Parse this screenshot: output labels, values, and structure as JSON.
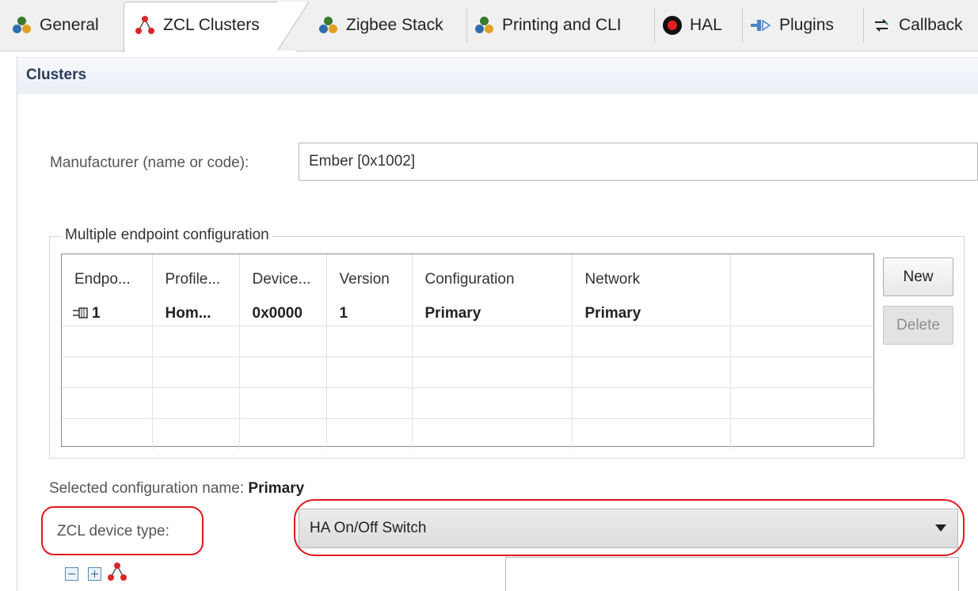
{
  "tabs": [
    {
      "label": "General",
      "icon": "cluster-icon"
    },
    {
      "label": "ZCL Clusters",
      "icon": "zcl-icon",
      "active": true
    },
    {
      "label": "Zigbee Stack",
      "icon": "cluster-icon"
    },
    {
      "label": "Printing and CLI",
      "icon": "cluster-icon"
    },
    {
      "label": "HAL",
      "icon": "hal-icon"
    },
    {
      "label": "Plugins",
      "icon": "plugin-icon"
    },
    {
      "label": "Callback",
      "icon": "callback-icon"
    }
  ],
  "section": {
    "title": "Clusters"
  },
  "manufacturer": {
    "label": "Manufacturer (name or code):",
    "value": "Ember [0x1002]"
  },
  "endpoints": {
    "group_label": "Multiple endpoint configuration",
    "columns": [
      "Endpo...",
      "Profile...",
      "Device...",
      "Version",
      "Configuration",
      "Network",
      ""
    ],
    "rows": [
      {
        "endpoint": "1",
        "profile": "Hom...",
        "device": "0x0000",
        "version": "1",
        "configuration": "Primary",
        "network": "Primary"
      }
    ],
    "new_label": "New",
    "delete_label": "Delete"
  },
  "selected_config": {
    "label": "Selected configuration name:",
    "value": "Primary"
  },
  "device_type": {
    "label": "ZCL device type:",
    "value": "HA On/Off Switch"
  },
  "colors": {
    "highlight": "#e0161b",
    "accent": "#2a3b5a"
  }
}
